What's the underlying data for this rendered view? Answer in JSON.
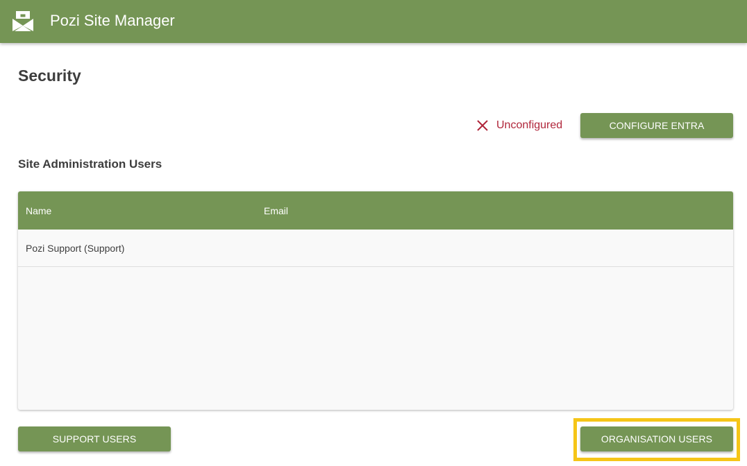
{
  "app": {
    "title": "Pozi Site Manager",
    "logo_icon": "pozi-logo-icon",
    "brand_color": "#759555"
  },
  "page": {
    "title": "Security"
  },
  "entra": {
    "status_icon": "close-icon",
    "status_text": "Unconfigured",
    "status_color": "#b0263a",
    "configure_label": "CONFIGURE ENTRA"
  },
  "admins": {
    "section_title": "Site Administration Users",
    "columns": [
      "Name",
      "Email"
    ],
    "rows": [
      {
        "name": "Pozi Support (Support)",
        "email": ""
      }
    ]
  },
  "footer": {
    "support_users_label": "SUPPORT USERS",
    "organisation_users_label": "ORGANISATION USERS",
    "highlight_color": "#f5c518"
  }
}
